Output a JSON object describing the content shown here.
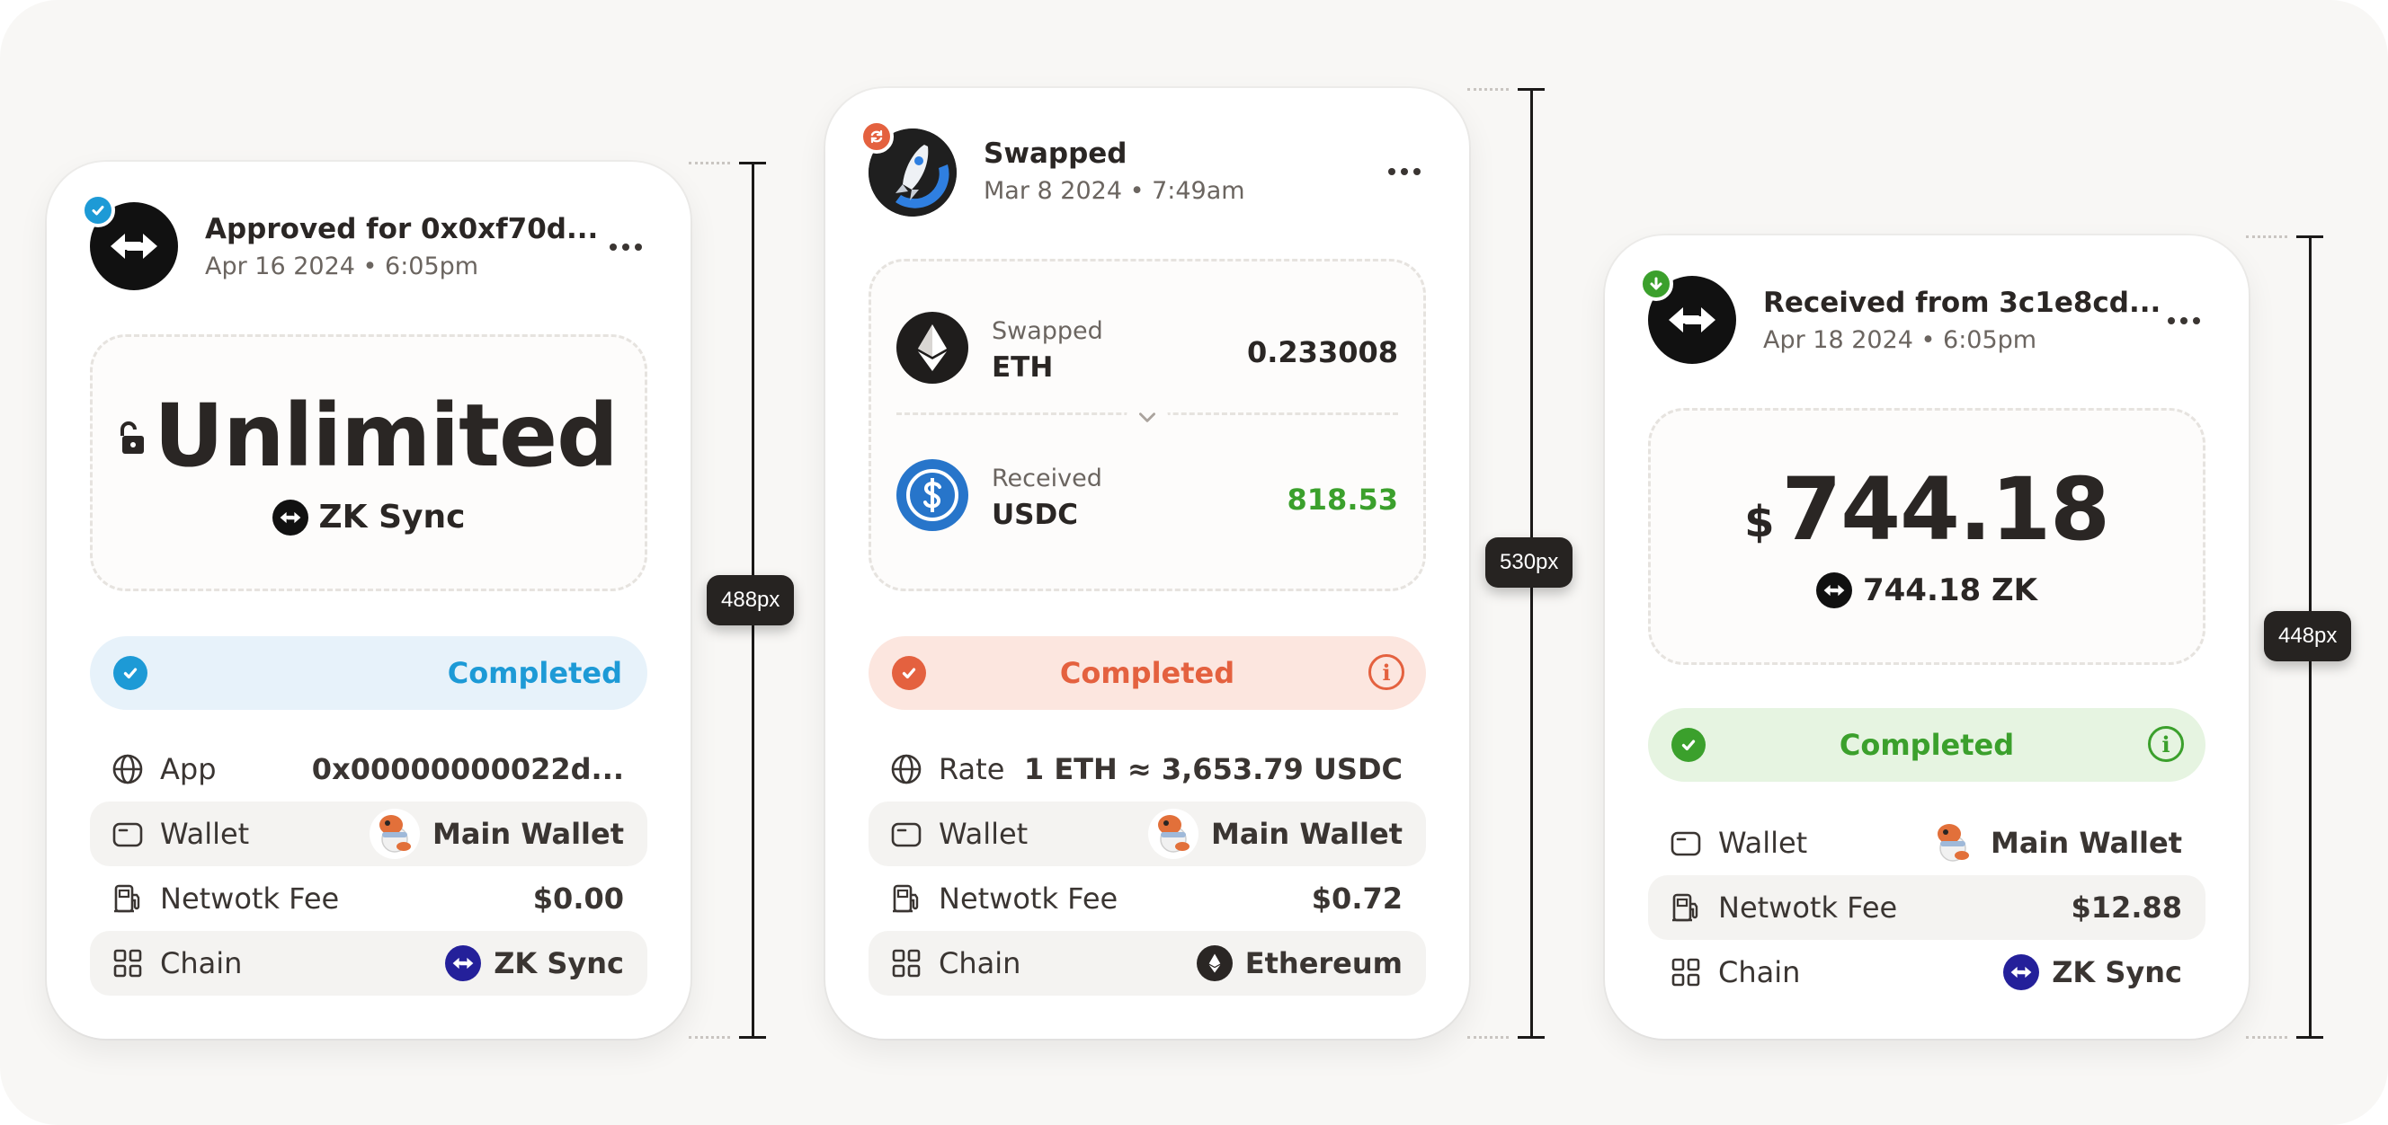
{
  "colors": {
    "approve_accent": "#1d9ad6",
    "swap_accent": "#e4613f",
    "receive_accent": "#3ba02c",
    "received_amount": "#3ba02c"
  },
  "cards": [
    {
      "title": "Approved for 0x0xf70d...",
      "date": "Apr 16 2024 • 6:05pm",
      "badge_icon": "check-badge-icon",
      "amount_main": "Unlimited",
      "amount_sub": "ZK Sync",
      "status": "Completed",
      "rows": [
        {
          "label": "App",
          "value": "0x00000000022d...",
          "icon": "globe-icon"
        },
        {
          "label": "Wallet",
          "value": "Main Wallet",
          "icon": "wallet-icon"
        },
        {
          "label": "Netwotk Fee",
          "value": "$0.00",
          "icon": "fuel-pump-icon"
        },
        {
          "label": "Chain",
          "value": "ZK Sync",
          "icon": "chain-icon"
        }
      ]
    },
    {
      "title": "Swapped",
      "date": "Mar 8 2024 • 7:49am",
      "badge_icon": "swap-badge-icon",
      "swap_from": {
        "label": "Swapped",
        "symbol": "ETH",
        "amount": "0.233008"
      },
      "swap_to": {
        "label": "Received",
        "symbol": "USDC",
        "amount": "818.53"
      },
      "status": "Completed",
      "rows": [
        {
          "label": "Rate",
          "value_prefix": "1 ETH ≈ ",
          "value": "3,653.79 USDC",
          "icon": "globe-icon"
        },
        {
          "label": "Wallet",
          "value": "Main Wallet",
          "icon": "wallet-icon"
        },
        {
          "label": "Netwotk Fee",
          "value": "$0.72",
          "icon": "fuel-pump-icon"
        },
        {
          "label": "Chain",
          "value": "Ethereum",
          "icon": "chain-icon"
        }
      ]
    },
    {
      "title": "Received from 3c1e8cd...",
      "date": "Apr 18 2024 • 6:05pm",
      "badge_icon": "download-badge-icon",
      "currency": "$",
      "amount_main": "744.18",
      "amount_sub": "744.18 ZK",
      "status": "Completed",
      "rows": [
        {
          "label": "Wallet",
          "value": "Main Wallet",
          "icon": "wallet-icon"
        },
        {
          "label": "Netwotk Fee",
          "value": "$12.88",
          "icon": "fuel-pump-icon"
        },
        {
          "label": "Chain",
          "value": "ZK Sync",
          "icon": "chain-icon"
        }
      ]
    }
  ],
  "measures": [
    "488px",
    "530px",
    "448px"
  ]
}
